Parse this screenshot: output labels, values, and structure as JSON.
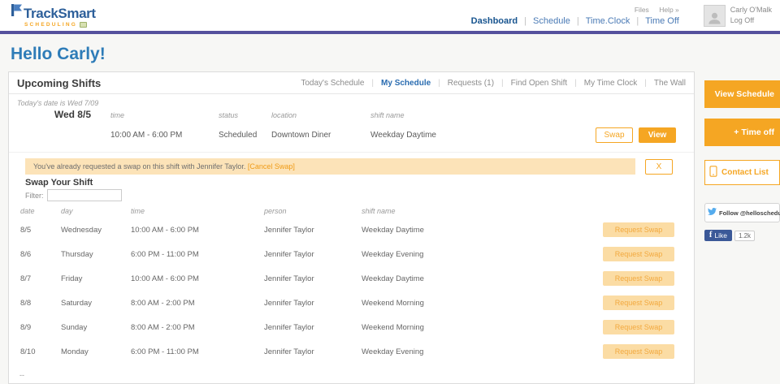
{
  "colors": {
    "accent_orange": "#f5a623",
    "brand_blue": "#2d5f9a",
    "divider_purple": "#55519d",
    "notice_bg": "#fce3b8",
    "twitter_blue": "#55acee",
    "facebook_blue": "#3b5998"
  },
  "header": {
    "logo": {
      "brand": "TrackSmart",
      "sub": "SCHEDULING"
    },
    "top_links": {
      "files": "Files",
      "help": "Help »"
    },
    "nav": [
      {
        "label": "Dashboard"
      },
      {
        "label": "Schedule"
      },
      {
        "label": "Time.Clock"
      },
      {
        "label": "Time Off"
      }
    ],
    "user": {
      "name": "Carly O'Malk",
      "log_off": "Log Off"
    }
  },
  "greeting": "Hello Carly!",
  "panel": {
    "title": "Upcoming Shifts",
    "tabs": [
      {
        "label": "Today's Schedule"
      },
      {
        "label": "My Schedule"
      },
      {
        "label": "Requests (1)"
      },
      {
        "label": "Find Open Shift"
      },
      {
        "label": "My Time Clock"
      },
      {
        "label": "The Wall"
      }
    ],
    "today_note": "Today's date is Wed 7/09",
    "upcoming": {
      "date": "Wed 8/5",
      "headers": {
        "time": "time",
        "status": "status",
        "location": "location",
        "shift_name": "shift name"
      },
      "shift": {
        "time": "10:00 AM - 6:00 PM",
        "status": "Scheduled",
        "location": "Downtown Diner",
        "shift_name": "Weekday Daytime"
      },
      "swap_label": "Swap",
      "view_label": "View"
    },
    "notice": {
      "text": "You've already requested a swap on this shift with Jennifer Taylor.",
      "link": "[Cancel Swap]",
      "close_label": "X"
    },
    "swap": {
      "title": "Swap Your Shift",
      "filter_label": "Filter:",
      "filter_value": "",
      "headers": {
        "date": "date",
        "day": "day",
        "time": "time",
        "person": "person",
        "shift_name": "shift name"
      },
      "request_label": "Request Swap",
      "rows": [
        {
          "date": "8/5",
          "day": "Wednesday",
          "time": "10:00 AM - 6:00 PM",
          "person": "Jennifer Taylor",
          "shift_name": "Weekday Daytime"
        },
        {
          "date": "8/6",
          "day": "Thursday",
          "time": "6:00 PM - 11:00 PM",
          "person": "Jennifer Taylor",
          "shift_name": "Weekday Evening"
        },
        {
          "date": "8/7",
          "day": "Friday",
          "time": "10:00 AM - 6:00 PM",
          "person": "Jennifer Taylor",
          "shift_name": "Weekday Daytime"
        },
        {
          "date": "8/8",
          "day": "Saturday",
          "time": "8:00 AM - 2:00 PM",
          "person": "Jennifer Taylor",
          "shift_name": "Weekend Morning"
        },
        {
          "date": "8/9",
          "day": "Sunday",
          "time": "8:00 AM - 2:00 PM",
          "person": "Jennifer Taylor",
          "shift_name": "Weekend Morning"
        },
        {
          "date": "8/10",
          "day": "Monday",
          "time": "6:00 PM - 11:00 PM",
          "person": "Jennifer Taylor",
          "shift_name": "Weekday Evening"
        }
      ],
      "footer": "--"
    }
  },
  "sidebar": {
    "view_schedule": "View Schedule",
    "time_off": "+ Time off",
    "contact_list": "Contact List",
    "twitter_label": "Follow @helloscheduling",
    "facebook_f": "f",
    "facebook_like": "Like",
    "facebook_count": "1.2k"
  }
}
